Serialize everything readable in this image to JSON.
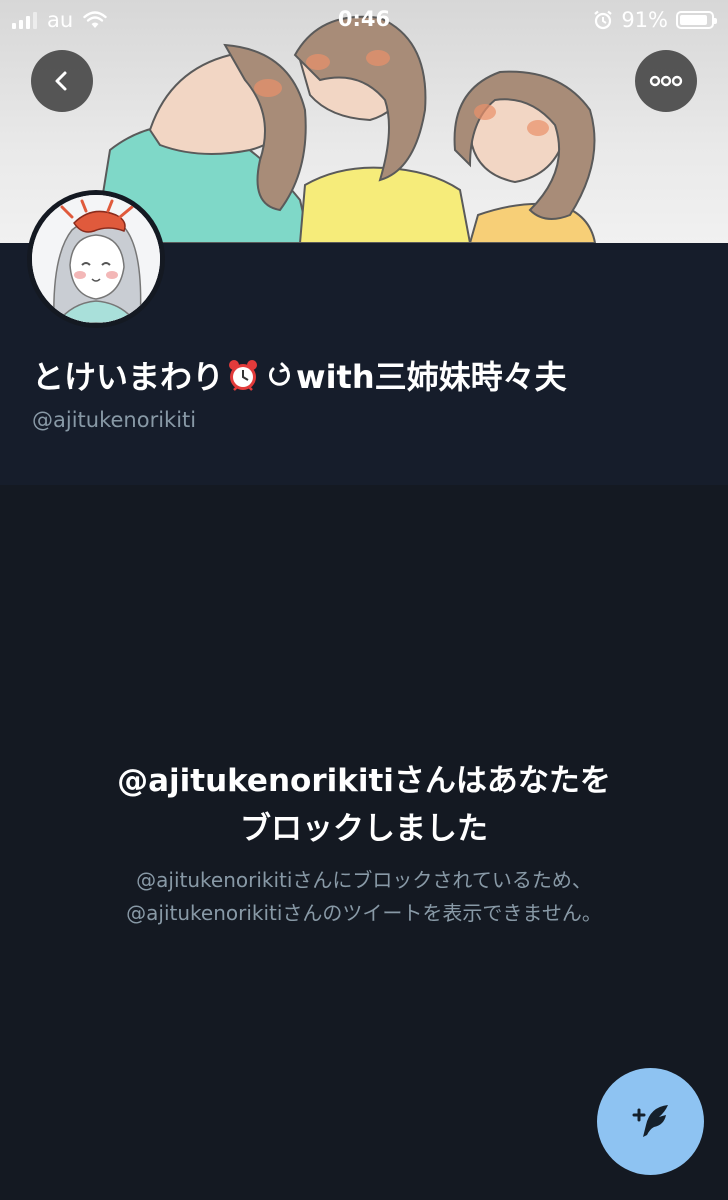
{
  "status_bar": {
    "carrier": "au",
    "time": "0:46",
    "battery": "91%",
    "battery_level": 0.91
  },
  "header": {
    "back_icon": "chevron-left-icon",
    "more_icon": "ellipsis-icon"
  },
  "profile": {
    "display_name_part1": "とけいまわり",
    "display_name_part2": "with三姉妹時々夫",
    "handle": "@ajitukenorikiti"
  },
  "blocked": {
    "title_line1": "@ajitukenorikitiさんはあなたを",
    "title_line2": "ブロックしました",
    "desc_line1": "@ajitukenorikitiさんにブロックされているため、",
    "desc_line2": "@ajitukenorikitiさんのツイートを表示できません。"
  },
  "fab": {
    "icon": "compose-tweet-icon"
  },
  "colors": {
    "background": "#141922",
    "profile_area": "#161d2b",
    "secondary_text": "#8899a6",
    "fab": "#8ec3f2"
  }
}
